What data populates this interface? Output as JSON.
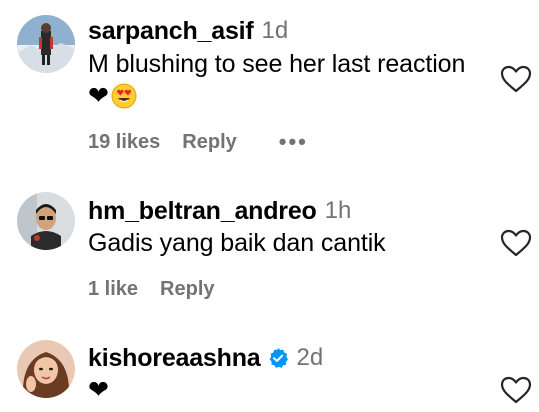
{
  "comments": [
    {
      "username": "sarpanch_asif",
      "time": "1d",
      "text": "M blushing to see her last reaction",
      "emoji_line": [
        "❤",
        "😍"
      ],
      "likes": "19 likes",
      "reply": "Reply",
      "more": "•••"
    },
    {
      "username": "hm_beltran_andreo",
      "time": "1h",
      "text": "Gadis yang baik dan cantik",
      "likes": "1 like",
      "reply": "Reply"
    },
    {
      "username": "kishoreaashna",
      "time": "2d",
      "verified": true,
      "emoji_line": [
        "❤"
      ]
    }
  ],
  "colors": {
    "secondary_text": "#737373",
    "verified_badge": "#0095f6",
    "heart_outline": "#262626"
  },
  "icons": {
    "like": "heart-outline-icon",
    "verified": "verified-badge-icon",
    "more": "more-options-icon"
  }
}
